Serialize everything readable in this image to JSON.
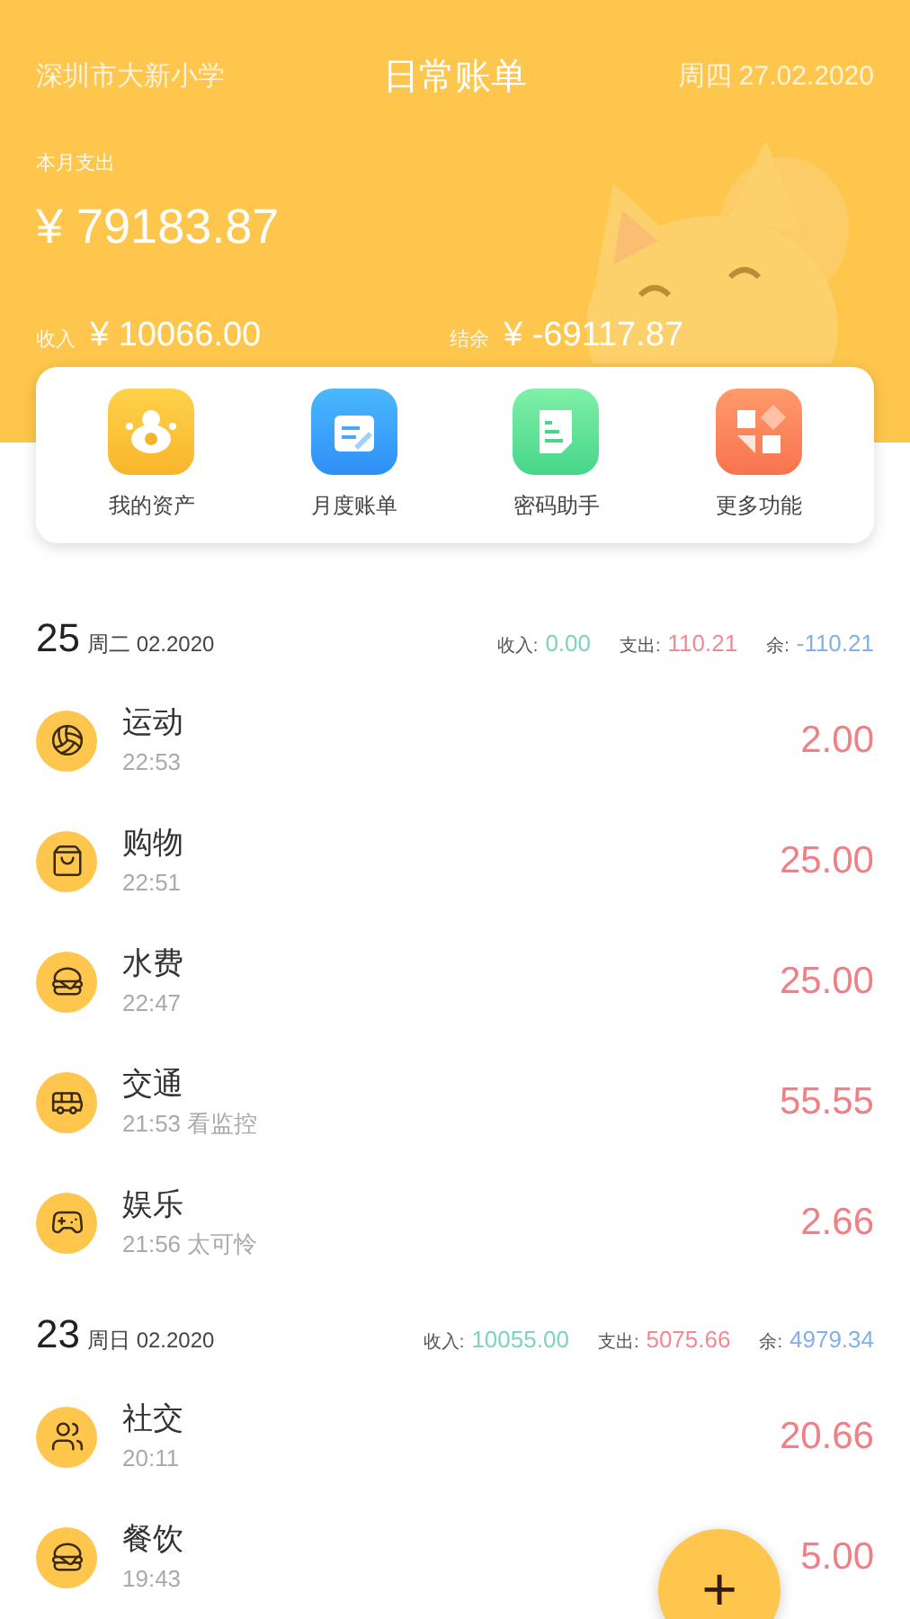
{
  "header": {
    "location": "深圳市大新小学",
    "title": "日常账单",
    "date": "周四 27.02.2020",
    "month_label": "本月支出",
    "month_amount": "¥ 79183.87",
    "income_label": "收入",
    "income_amount": "¥ 10066.00",
    "balance_label": "结余",
    "balance_amount": "¥ -69117.87"
  },
  "features": [
    {
      "label": "我的资产"
    },
    {
      "label": "月度账单"
    },
    {
      "label": "密码助手"
    },
    {
      "label": "更多功能"
    }
  ],
  "days": [
    {
      "day": "25",
      "date": "周二 02.2020",
      "income_label": "收入:",
      "income": "0.00",
      "expense_label": "支出:",
      "expense": "110.21",
      "balance_label": "余:",
      "balance": "-110.21",
      "entries": [
        {
          "category": "运动",
          "time": "22:53",
          "amount": "2.00"
        },
        {
          "category": "购物",
          "time": "22:51",
          "amount": "25.00"
        },
        {
          "category": "水费",
          "time": "22:47",
          "amount": "25.00"
        },
        {
          "category": "交通",
          "time": "21:53 看监控",
          "amount": "55.55"
        },
        {
          "category": "娱乐",
          "time": "21:56 太可怜",
          "amount": "2.66"
        }
      ]
    },
    {
      "day": "23",
      "date": "周日 02.2020",
      "income_label": "收入:",
      "income": "10055.00",
      "expense_label": "支出:",
      "expense": "5075.66",
      "balance_label": "余:",
      "balance": "4979.34",
      "entries": [
        {
          "category": "社交",
          "time": "20:11",
          "amount": "20.66"
        },
        {
          "category": "餐饮",
          "time": "19:43",
          "amount": "5.00"
        }
      ]
    }
  ],
  "fab": {
    "label": "+"
  }
}
